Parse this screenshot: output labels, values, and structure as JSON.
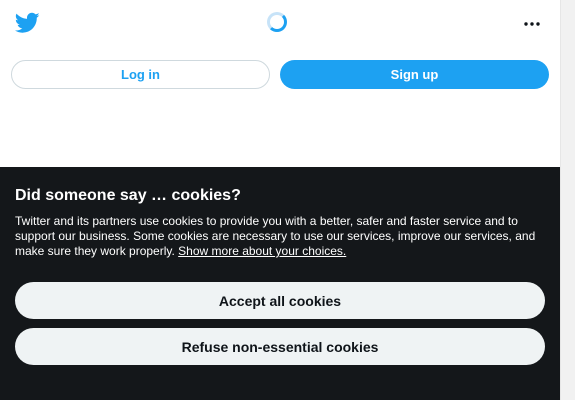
{
  "header": {
    "logo_icon": "twitter-bird-icon",
    "loading_icon": "loading-spinner-icon",
    "more_icon": "more-dots-icon"
  },
  "auth": {
    "login_label": "Log in",
    "signup_label": "Sign up"
  },
  "cookies": {
    "title": "Did someone say … cookies?",
    "body": "Twitter and its partners use cookies to provide you with a better, safer and faster service and to support our business. Some cookies are necessary to use our services, improve our services, and make sure they work properly. ",
    "link_label": "Show more about your choices.",
    "accept_label": "Accept all cookies",
    "refuse_label": "Refuse non-essential cookies"
  },
  "colors": {
    "brand_blue": "#1da1f2",
    "banner_bg": "#14171a",
    "button_bg": "#eff3f4"
  }
}
